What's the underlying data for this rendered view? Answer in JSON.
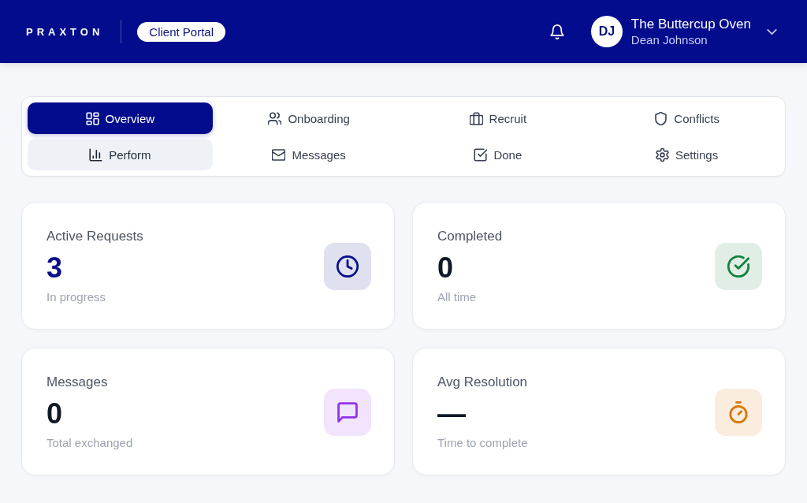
{
  "header": {
    "logo": "PRAXTON",
    "portal_label": "Client Portal",
    "account": {
      "initials": "DJ",
      "organization": "The Buttercup Oven",
      "user": "Dean Johnson"
    }
  },
  "tabs": [
    {
      "label": "Overview",
      "kind": "grid",
      "selected": true,
      "hovered": false
    },
    {
      "label": "Onboarding",
      "kind": "users",
      "selected": false,
      "hovered": false
    },
    {
      "label": "Recruit",
      "kind": "briefcase",
      "selected": false,
      "hovered": false
    },
    {
      "label": "Conflicts",
      "kind": "shield",
      "selected": false,
      "hovered": false
    },
    {
      "label": "Perform",
      "kind": "chart",
      "selected": false,
      "hovered": true
    },
    {
      "label": "Messages",
      "kind": "mail",
      "selected": false,
      "hovered": false
    },
    {
      "label": "Done",
      "kind": "checkbox",
      "selected": false,
      "hovered": false
    },
    {
      "label": "Settings",
      "kind": "gear",
      "selected": false,
      "hovered": false
    }
  ],
  "stats": [
    {
      "title": "Active Requests",
      "value": "3",
      "caption": "In progress",
      "kind": "clock",
      "color": "#0a0f8a",
      "value_highlighted": true
    },
    {
      "title": "Completed",
      "value": "0",
      "caption": "All time",
      "kind": "done",
      "color": "#15803d",
      "value_highlighted": false
    },
    {
      "title": "Messages",
      "value": "0",
      "caption": "Total exchanged",
      "kind": "chat",
      "color": "#9333ea",
      "value_highlighted": false
    },
    {
      "title": "Avg Resolution",
      "value": "—",
      "caption": "Time to complete",
      "kind": "timer",
      "color": "#d97706",
      "value_highlighted": false
    }
  ]
}
